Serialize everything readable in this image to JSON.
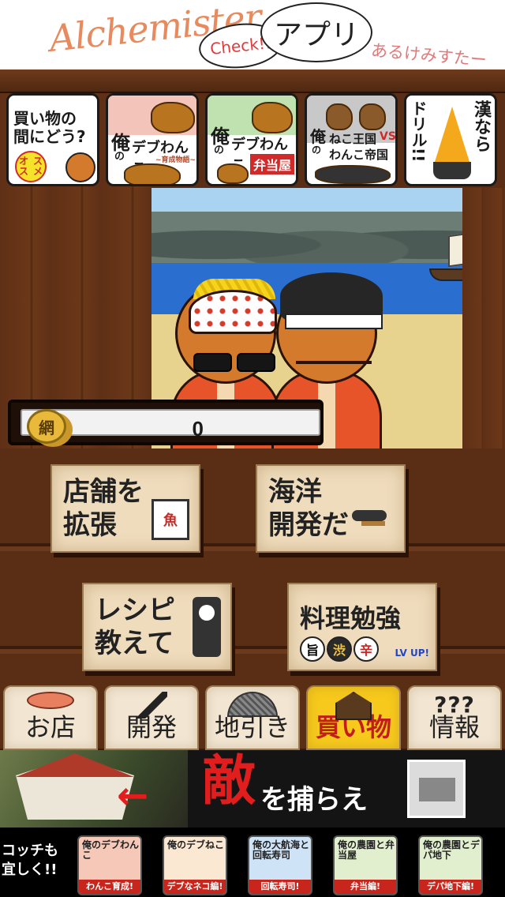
{
  "header_banner": {
    "brand": "Alchemister",
    "check_bubble": "Check!!",
    "app_bubble": "アプリ",
    "subtitle": "あるけみすたー"
  },
  "ads_top": [
    {
      "line1": "買い物の",
      "line2": "間にどう?",
      "badge_line1": "オス",
      "badge_line2": "スメ"
    },
    {
      "kanji": "俺",
      "no": "の",
      "title": "デブわんこ",
      "sub": "~育成物語~"
    },
    {
      "kanji": "俺",
      "no": "の",
      "title": "デブわんこ",
      "sub": "弁当屋"
    },
    {
      "kanji": "俺",
      "no": "の",
      "title1": "ねこ王国",
      "vs": "VS",
      "title2": "わんこ帝国"
    },
    {
      "line1": "漢なら",
      "line2": "ドリル!!"
    }
  ],
  "net_counter": {
    "coin_label": "網",
    "value": "0"
  },
  "actions": {
    "expand": {
      "line1": "店舗を",
      "line2": "拡張",
      "sign": "魚"
    },
    "develop": {
      "line1": "海洋",
      "line2": "開発だ"
    },
    "recipe": {
      "line1": "レシピ",
      "line2": "教えて"
    },
    "study": {
      "label": "料理勉強",
      "flavors": [
        "旨",
        "渋",
        "辛"
      ],
      "lvup": "LV UP!"
    }
  },
  "tabs": [
    {
      "id": "shop",
      "label": "お店",
      "icon": "salmon-icon"
    },
    {
      "id": "dev",
      "label": "開発",
      "icon": "knife-icon"
    },
    {
      "id": "net",
      "label": "地引き",
      "icon": "net-icon"
    },
    {
      "id": "buy",
      "label": "買い物",
      "icon": "house-icon",
      "active": true
    },
    {
      "id": "info",
      "label": "情報",
      "icon": "question-icon",
      "icon_text": "???"
    }
  ],
  "bottom_banner": {
    "arrow": "←",
    "kanji": "敵",
    "rest": "を捕らえ"
  },
  "promo": {
    "lead_line1": "コッチも",
    "lead_line2": "宜しく!!",
    "items": [
      {
        "title": "俺のデブわんこ",
        "caption": "わんこ育成!"
      },
      {
        "title": "俺のデブねこ",
        "caption": "デブなネコ編!"
      },
      {
        "title": "俺の大航海と回転寿司",
        "caption": "回転寿司!"
      },
      {
        "title": "俺の農園と弁当屋",
        "caption": "弁当編!"
      },
      {
        "title": "俺の農園とデパ地下",
        "caption": "デパ地下編!"
      }
    ]
  },
  "colors": {
    "active_tab": "#f6c91c",
    "active_tab_text": "#c21c1c",
    "wood": "#5a2e14",
    "banner_red": "#e21d1d"
  }
}
